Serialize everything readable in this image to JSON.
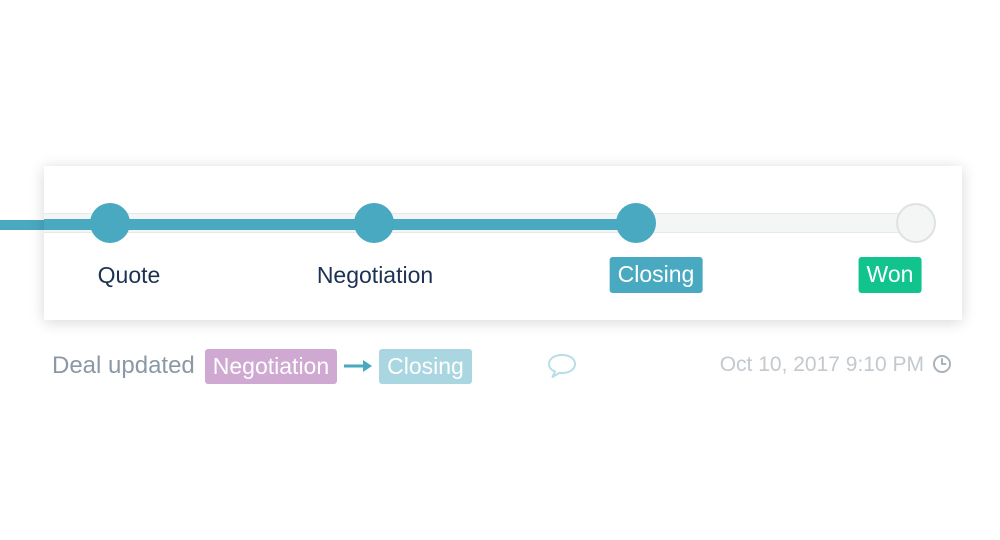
{
  "pipeline": {
    "stages": [
      {
        "label": "Quote",
        "state": "completed"
      },
      {
        "label": "Negotiation",
        "state": "completed"
      },
      {
        "label": "Closing",
        "state": "current"
      },
      {
        "label": "Won",
        "state": "future"
      }
    ]
  },
  "activity": {
    "label": "Deal updated",
    "from_stage": "Negotiation",
    "to_stage": "Closing",
    "timestamp": "Oct 10, 2017 9:10 PM"
  },
  "icons": {
    "arrow": "arrow-right-icon",
    "comment": "speech-bubble-icon",
    "time": "clock-icon"
  },
  "colors": {
    "accent": "#49a9c1",
    "won": "#11c48e",
    "from_badge": "#cfa9d2",
    "to_badge": "#a9d6e1",
    "title_text": "#1d3253",
    "muted_text": "#8b98a6"
  }
}
